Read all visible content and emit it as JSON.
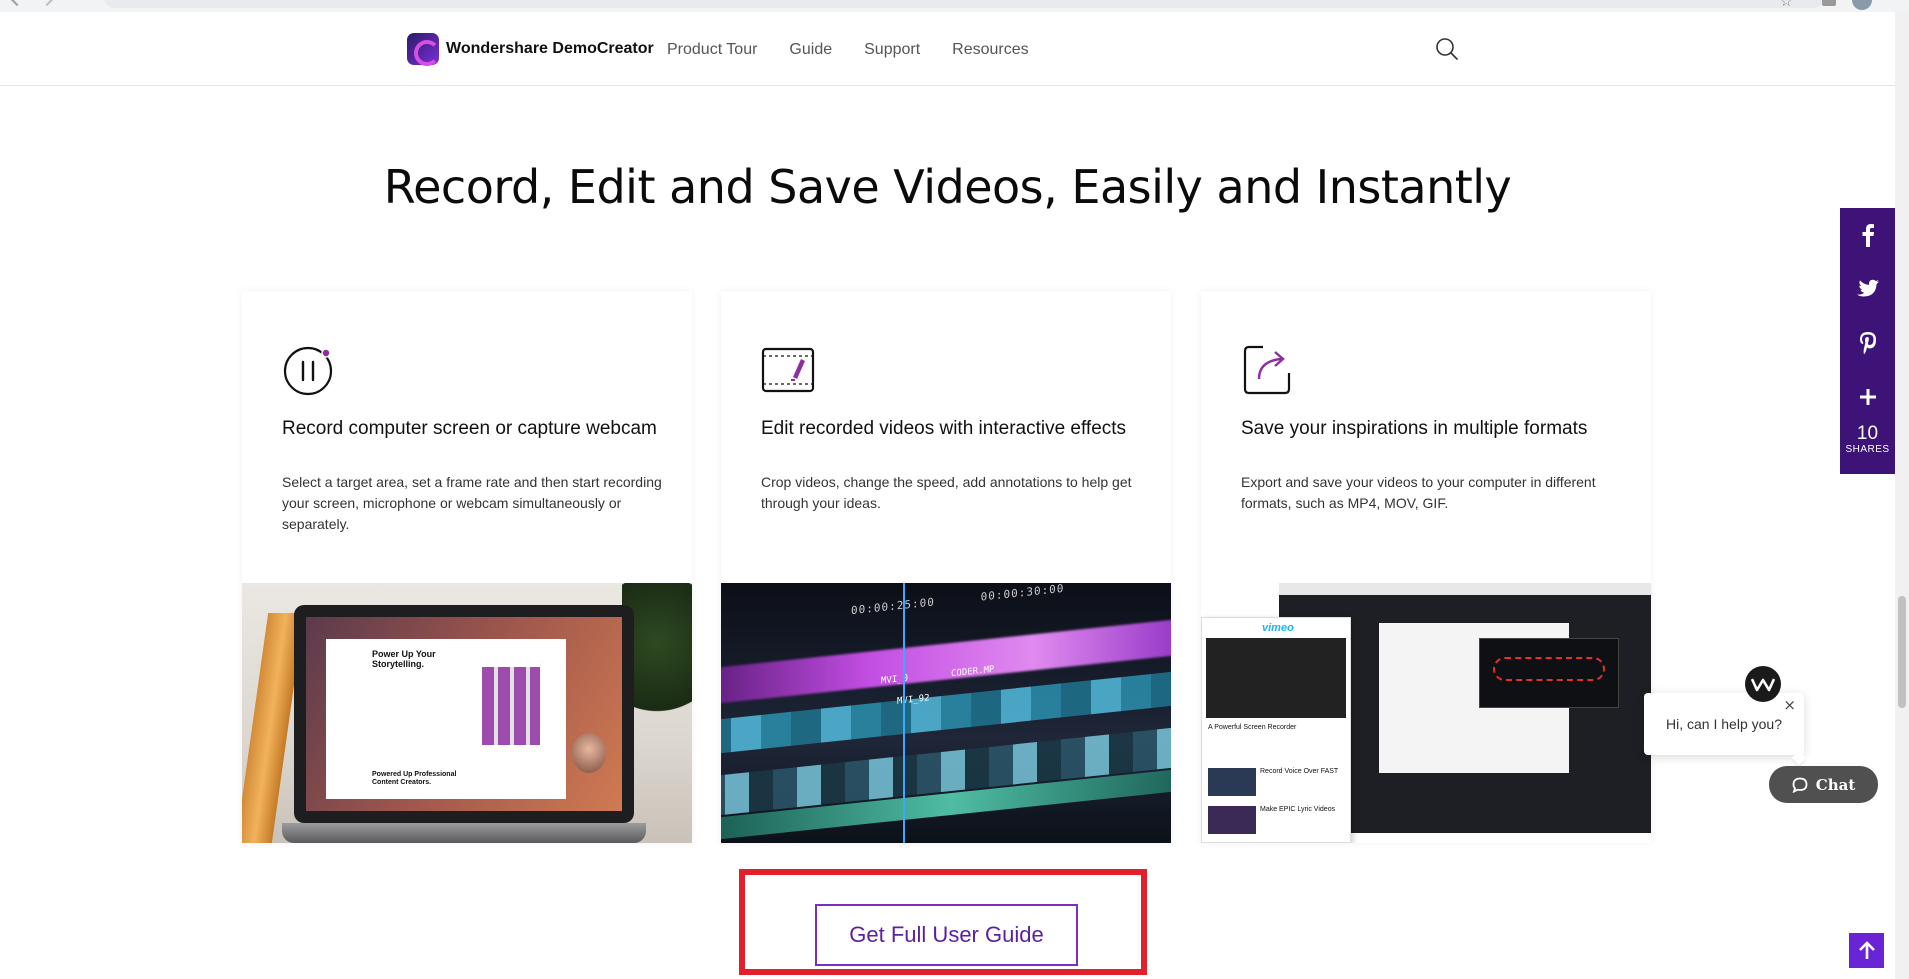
{
  "site": {
    "brand": "Wondershare DemoCreator",
    "nav": [
      "Product Tour",
      "Guide",
      "Support",
      "Resources"
    ]
  },
  "hero": {
    "title": "Record, Edit and Save Videos, Easily and Instantly"
  },
  "features": [
    {
      "title": "Record computer screen or capture webcam",
      "description": "Select a target area, set a frame rate and then start recording your screen, microphone or webcam simultaneously or separately.",
      "icon": "record-pause-icon"
    },
    {
      "title": "Edit recorded videos with interactive effects",
      "description": "Crop videos, change the speed, add annotations to help get through your ideas.",
      "icon": "edit-video-icon"
    },
    {
      "title": "Save your inspirations in multiple formats",
      "description": "Export and save your videos to your computer in different formats, such as MP4, MOV, GIF.",
      "icon": "share-export-icon"
    }
  ],
  "images": {
    "laptop_heading": "Power Up Your Storytelling.",
    "laptop_footer": "Powered Up Professional Content Creators.",
    "timeline_ticks": "00:00:25:00      00:00:30:00",
    "clips": [
      "MVI_0",
      "CODER.MP",
      "MVI_92"
    ],
    "vimeo": "vimeo",
    "video_title": "A Powerful Screen Recorder",
    "related": [
      "Record Voice Over FAST",
      "Make EPIC Lyric Videos"
    ]
  },
  "cta": {
    "label": "Get Full User Guide"
  },
  "share": {
    "count": "10",
    "label": "SHARES"
  },
  "chat": {
    "message": "Hi, can I help you?",
    "button": "Chat"
  },
  "colors": {
    "brand_purple": "#3d1378",
    "accent_purple": "#7b2fbe",
    "highlight_red": "#e0202a"
  }
}
